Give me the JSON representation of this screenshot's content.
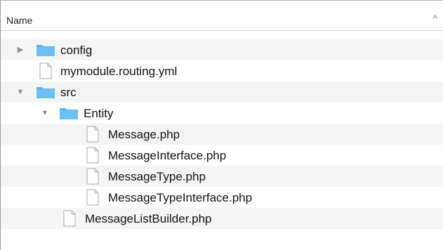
{
  "header": {
    "name_label": "Name",
    "sort_indicator": "^"
  },
  "icons": {
    "folder": "folder-icon",
    "file": "document-icon",
    "collapsed": "disclosure-right-icon",
    "expanded": "disclosure-down-icon",
    "folder_color": "#5ab3f1"
  },
  "tree": [
    {
      "label": "config",
      "type": "folder",
      "state": "collapsed"
    },
    {
      "label": "mymodule.routing.yml",
      "type": "file"
    },
    {
      "label": "src",
      "type": "folder",
      "state": "expanded"
    },
    {
      "label": "Entity",
      "type": "folder",
      "state": "expanded"
    },
    {
      "label": "Message.php",
      "type": "file"
    },
    {
      "label": "MessageInterface.php",
      "type": "file"
    },
    {
      "label": "MessageType.php",
      "type": "file"
    },
    {
      "label": "MessageTypeInterface.php",
      "type": "file"
    },
    {
      "label": "MessageListBuilder.php",
      "type": "file"
    }
  ]
}
